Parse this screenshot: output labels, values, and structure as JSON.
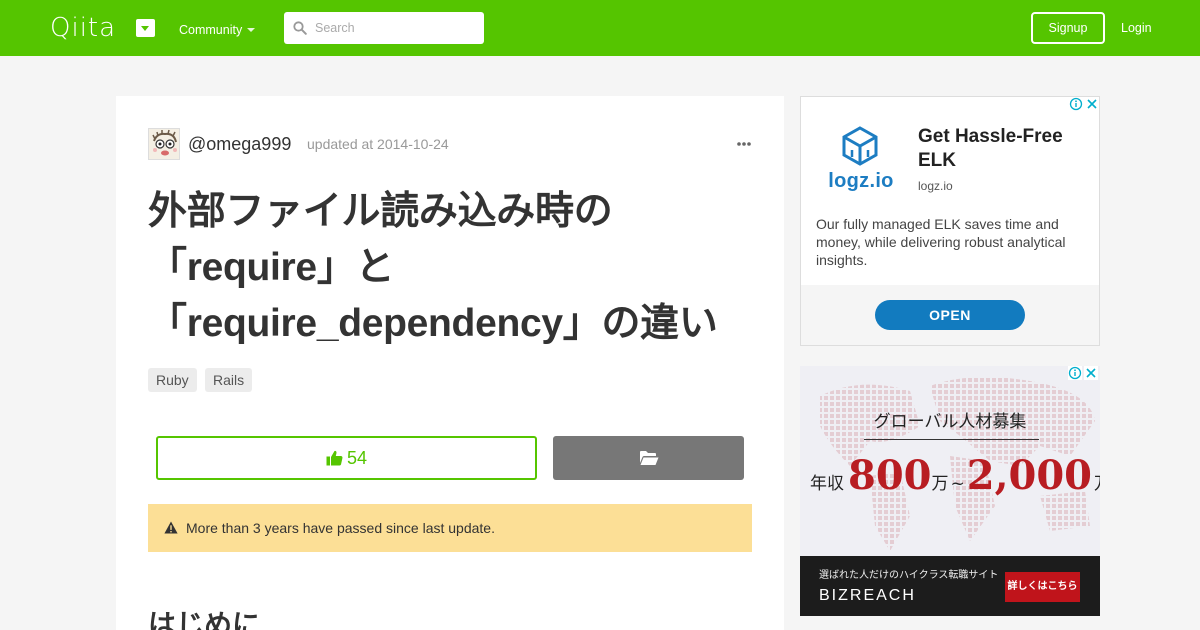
{
  "header": {
    "logo": "Qiita",
    "community_label": "Community",
    "search_placeholder": "Search",
    "signup_label": "Signup",
    "login_label": "Login",
    "brand_color": "#55c500"
  },
  "article": {
    "author": "@omega999",
    "updated": "updated at 2014-10-24",
    "title_lines": [
      "外部ファイル読み込み時の",
      "「require」と",
      "「require_dependency」の違い"
    ],
    "tags": [
      "Ruby",
      "Rails"
    ],
    "like_count": "54",
    "warning": "More than 3 years have passed since last update.",
    "section_heading": "はじめに"
  },
  "ads": {
    "ad1": {
      "logo_text": "logz.io",
      "title": "Get Hassle-Free ELK",
      "domain": "logz.io",
      "body": "Our fully managed ELK saves time and money, while delivering robust analytical insights.",
      "cta": "OPEN",
      "accent": "#127bbf"
    },
    "ad2": {
      "headline": "グローバル人材募集",
      "salary_prefix": "年収",
      "salary_low": "800",
      "salary_unit1": "万",
      "salary_tilde": "~",
      "salary_high": "2,000",
      "salary_unit2": "万円",
      "subtitle": "選ばれた人だけのハイクラス転職サイト",
      "brand": "BIZREACH",
      "cta": "詳しくはこちら",
      "accent": "#c0141b"
    }
  }
}
